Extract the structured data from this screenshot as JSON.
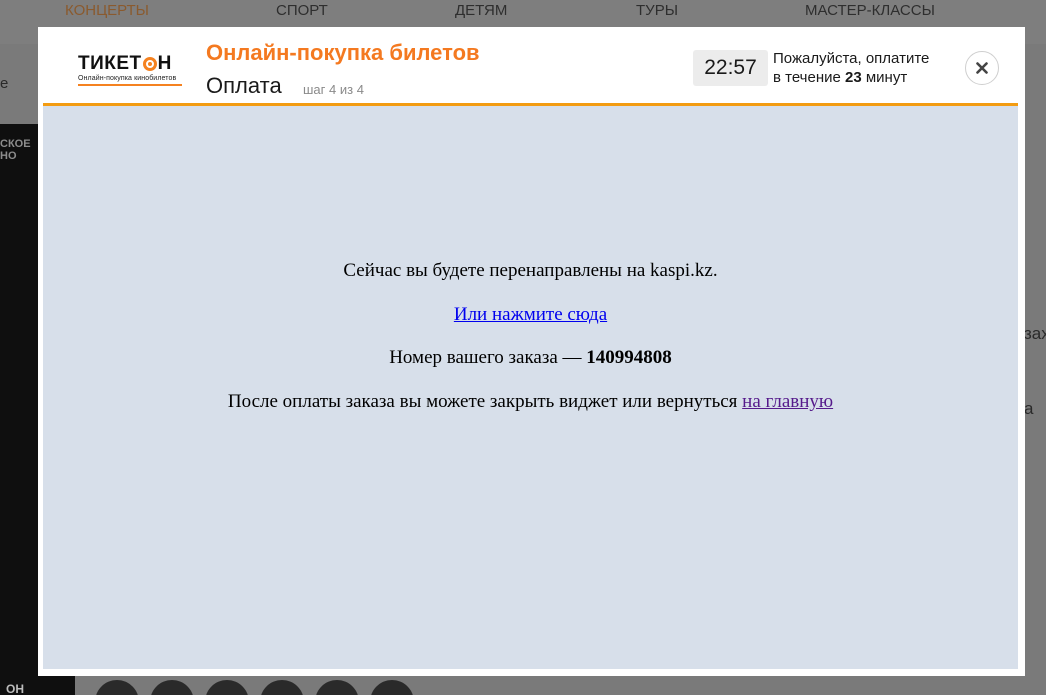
{
  "background": {
    "nav": [
      "КОНЦЕРТЫ",
      "СПОРТ",
      "ДЕТЯМ",
      "ТУРЫ",
      "МАСТЕР-КЛАССЫ"
    ],
    "left_fragment": "е",
    "poster_fragment": [
      "СКОЕ",
      "НО"
    ],
    "right_fragments": [
      "зах",
      "а"
    ],
    "bottom_fragment": "ОН"
  },
  "header": {
    "logo_word_part1": "ТИКЕТ",
    "logo_word_part2": "Н",
    "logo_tagline": "Онлайн-покупка кинобилетов",
    "title": "Онлайн-покупка билетов",
    "step_title": "Оплата",
    "step_info": "шаг 4 из 4",
    "timer": "22:57",
    "pay_note_line1": "Пожалуйста, оплатите",
    "pay_note_line2_prefix": "в течение ",
    "pay_note_minutes": "23",
    "pay_note_line2_suffix": " минут"
  },
  "body": {
    "redirect_text": "Сейчас вы будете перенаправлены на kaspi.kz.",
    "click_link": "Или нажмите сюда",
    "order_label": "Номер вашего заказа — ",
    "order_number": "140994808",
    "after_text": "После оплаты заказа вы можете закрыть виджет или вернуться ",
    "home_link": "на главную"
  },
  "colors": {
    "accent": "#f47920",
    "body_bg": "#d7dfea",
    "link": "#0000ee",
    "visited_link": "#551a8b"
  }
}
